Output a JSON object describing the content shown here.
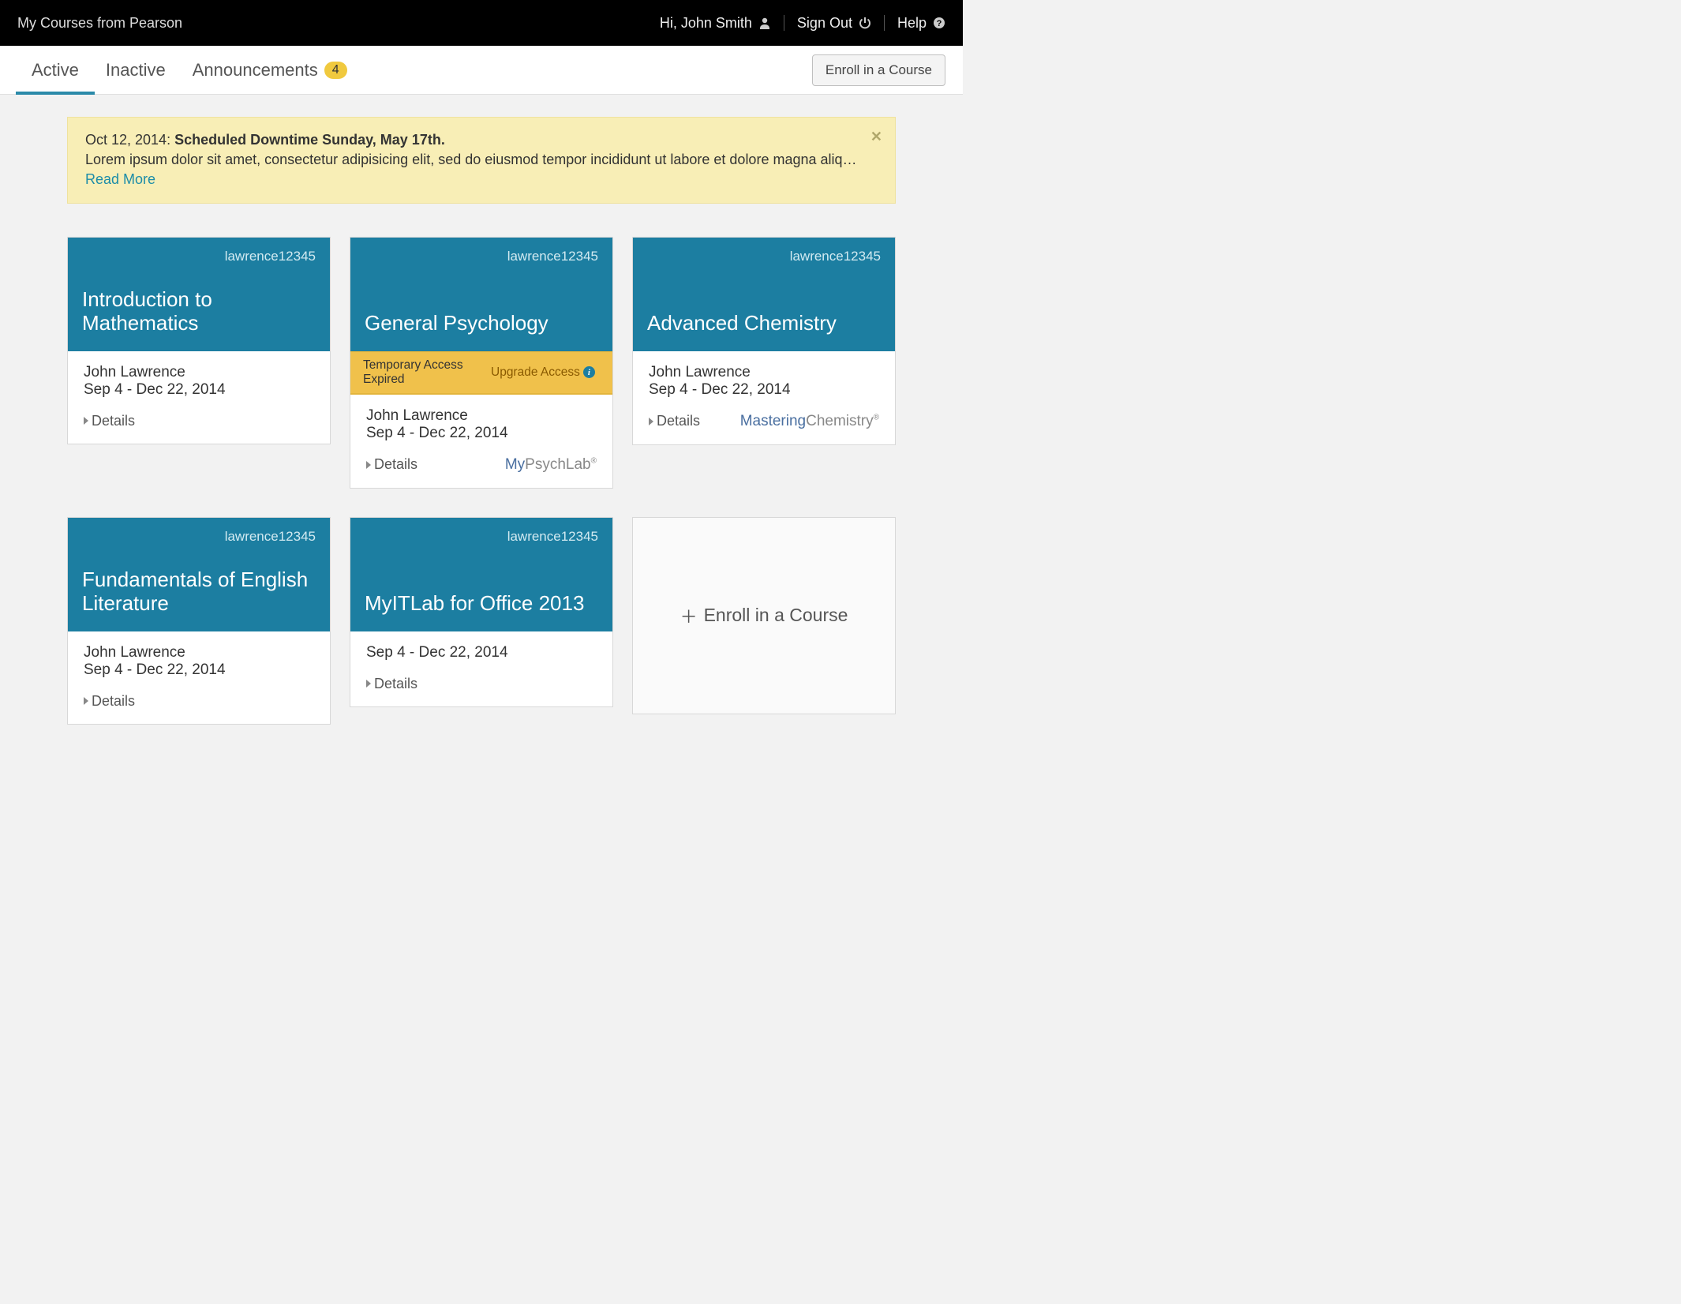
{
  "header": {
    "brand": "My Courses from Pearson",
    "greeting": "Hi, John Smith",
    "sign_out": "Sign Out",
    "help": "Help"
  },
  "tabs": {
    "active": "Active",
    "inactive": "Inactive",
    "announcements": "Announcements",
    "announcements_count": "4",
    "enroll_button": "Enroll in a Course"
  },
  "alert": {
    "date": "Oct 12, 2014:",
    "headline": "Scheduled Downtime Sunday, May 17th.",
    "body": "Lorem ipsum dolor sit amet, consectetur adipisicing elit, sed do eiusmod tempor incididunt ut labore et dolore magna aliq…",
    "read_more": "Read More"
  },
  "courses": [
    {
      "id": "lawrence12345",
      "title": "Introduction to Mathematics",
      "instructor": "John Lawrence",
      "dates": "Sep 4 - Dec 22, 2014",
      "details": "Details",
      "access_bar": null,
      "brand": null
    },
    {
      "id": "lawrence12345",
      "title": "General Psychology",
      "instructor": "John Lawrence",
      "dates": "Sep 4 - Dec 22, 2014",
      "details": "Details",
      "access_bar": {
        "status": "Temporary Access Expired",
        "upgrade": "Upgrade Access"
      },
      "brand": {
        "b1": "My",
        "b2": "PsychLab"
      }
    },
    {
      "id": "lawrence12345",
      "title": "Advanced Chemistry",
      "instructor": "John Lawrence",
      "dates": "Sep 4 - Dec 22, 2014",
      "details": "Details",
      "access_bar": null,
      "brand": {
        "b1": "Mastering",
        "b2": "Chemistry"
      }
    },
    {
      "id": "lawrence12345",
      "title": "Fundamentals of English Literature",
      "instructor": "John Lawrence",
      "dates": "Sep 4 - Dec 22, 2014",
      "details": "Details",
      "access_bar": null,
      "brand": null
    },
    {
      "id": "lawrence12345",
      "title": "MyITLab for Office 2013",
      "instructor": "",
      "dates": "Sep 4 - Dec 22, 2014",
      "details": "Details",
      "access_bar": null,
      "brand": null
    }
  ],
  "enroll_tile": {
    "label": "Enroll in a Course"
  }
}
